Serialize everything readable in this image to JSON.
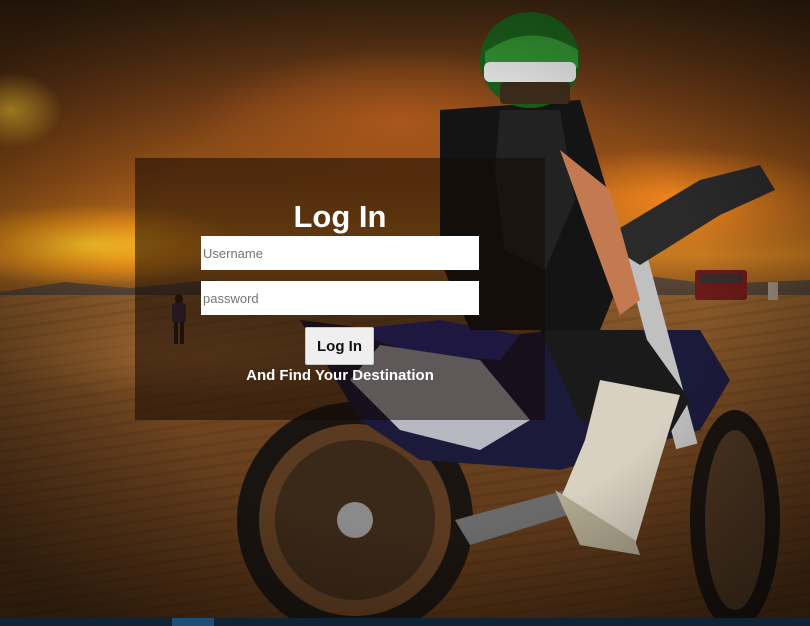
{
  "login": {
    "title": "Log In",
    "username_placeholder": "Username",
    "password_placeholder": "password",
    "username_value": "",
    "password_value": "",
    "button_label": "Log In",
    "tagline": "And Find Your Destination"
  },
  "colors": {
    "panel_overlay": "#140a04",
    "text": "#ffffff",
    "button_bg": "#efefef",
    "bottom_strip": "#0e2336",
    "bottom_strip_accent": "#1d4e7a"
  },
  "background": {
    "image": "sunset-dirt-bike-rider-photo"
  }
}
